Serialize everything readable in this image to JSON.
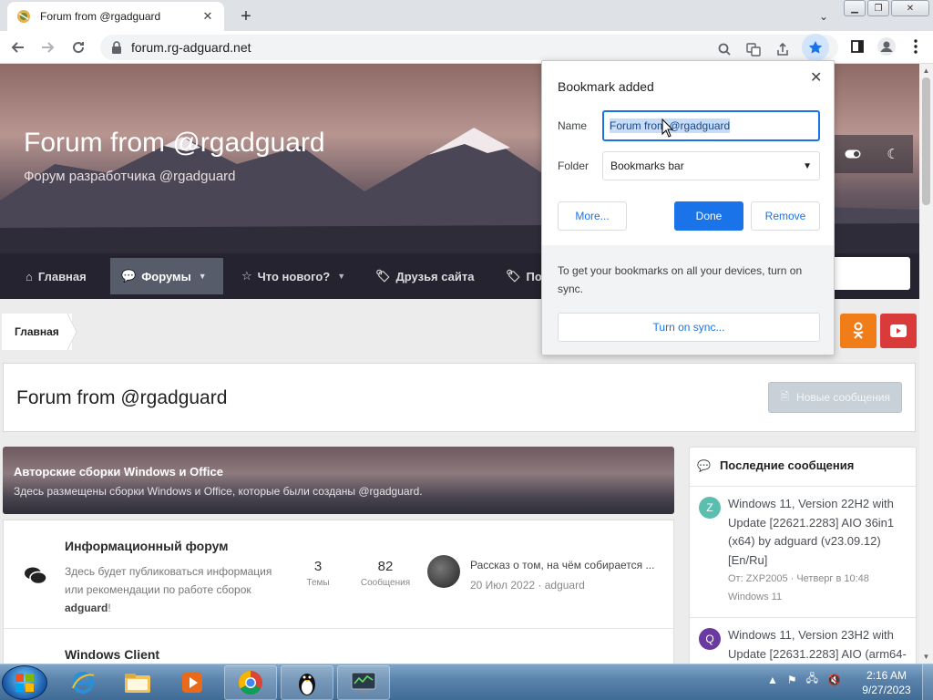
{
  "browser": {
    "tab_title": "Forum from @rgadguard",
    "url": "forum.rg-adguard.net"
  },
  "hero": {
    "title": "Forum from @rgadguard",
    "subtitle": "Форум разработчика @rgadguard"
  },
  "nav": {
    "home": "Главная",
    "forums": "Форумы",
    "whats_new": "Что нового?",
    "friends": "Друзья сайта",
    "partial": "По"
  },
  "breadcrumb": {
    "home": "Главная"
  },
  "page": {
    "title": "Forum from @rgadguard",
    "new_messages_btn": "Новые сообщения"
  },
  "category": {
    "title": "Авторские сборки Windows и Office",
    "description": "Здесь размещены сборки Windows и Office, которые были созданы @rgadguard."
  },
  "forums": [
    {
      "name": "Информационный форум",
      "description_line1": "Здесь будет публиковаться информация",
      "description_line2": "или рекомендации по работе сборок",
      "description_bold": "adguard",
      "description_end": "!",
      "topics": "3",
      "topics_label": "Темы",
      "messages": "82",
      "messages_label": "Сообщения",
      "last_title": "Рассказ о том, на чём собирается ...",
      "last_meta": "20 Июл 2022 · adguard"
    },
    {
      "name": "Windows Client"
    }
  ],
  "sidebar": {
    "header": "Последние сообщения",
    "posts": [
      {
        "avatar": "Z",
        "avatar_color": "#5bbfb0",
        "title": "Windows 11, Version 22H2 with Update [22621.2283] AIO 36in1 (x64) by adguard (v23.09.12) [En/Ru]",
        "meta_line1": "От: ZXP2005 · Четверг в 10:48",
        "meta_line2": "Windows 11"
      },
      {
        "avatar": "Q",
        "avatar_color": "#6a3aa0",
        "title": "Windows 11, Version 23H2 with Update [22631.2283] AIO (arm64-"
      }
    ]
  },
  "bookmark": {
    "title": "Bookmark added",
    "name_label": "Name",
    "name_value": "Forum from @rgadguard",
    "folder_label": "Folder",
    "folder_value": "Bookmarks bar",
    "more_btn": "More...",
    "done_btn": "Done",
    "remove_btn": "Remove",
    "sync_text": "To get your bookmarks on all your devices, turn on sync.",
    "sync_btn": "Turn on sync..."
  },
  "taskbar": {
    "time": "2:16 AM",
    "date": "9/27/2023"
  },
  "colors": {
    "chrome_blue": "#1a73e8",
    "odnoklassniki": "#f07d18",
    "youtube": "#d93a3a"
  }
}
